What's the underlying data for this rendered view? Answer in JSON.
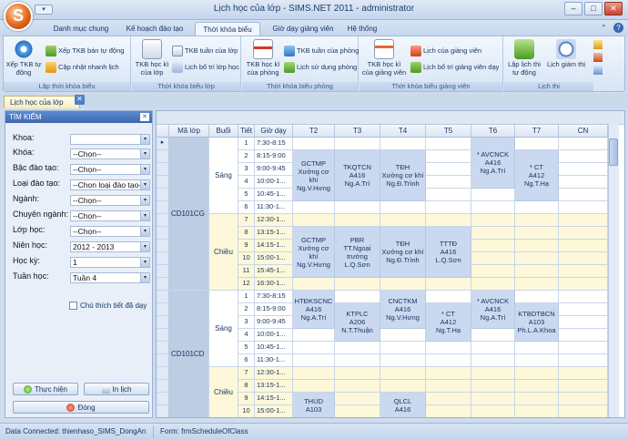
{
  "window": {
    "title": "Lịch học của lớp - SIMS.NET 2011 - administrator",
    "minimize": "–",
    "maximize": "□",
    "close": "✕"
  },
  "logo_letter": "S",
  "ribbon_tabs": [
    "Danh mục chung",
    "Kế hoạch đào tạo",
    "Thời khóa biểu",
    "Giờ dạy giảng viên",
    "Hệ thống"
  ],
  "ribbon_groups": {
    "g1": {
      "label": "Lập thời khóa biểu",
      "big": "Xếp TKB tự động",
      "s1": "Xếp TKB bán tự động",
      "s2": "Cập nhật nhanh lịch"
    },
    "g2": {
      "label": "Thời khóa biểu lớp",
      "big": "TKB học kì của lớp",
      "s1": "TKB tuần của lớp",
      "s2": "Lịch bố trí lớp học"
    },
    "g3": {
      "label": "Thời khóa biểu phòng",
      "big": "TKB học kì của phòng",
      "s1": "TKB tuần của phòng",
      "s2": "Lịch sử dụng phòng"
    },
    "g4": {
      "label": "Thời khóa biểu giảng viên",
      "big": "TKB học kì của giảng viên",
      "s1": "Lịch của giảng viên",
      "s2": "Lịch bố trí giảng viên dạy"
    },
    "g5": {
      "label": "Lịch thi",
      "b1": "Lập lịch thi tự động",
      "b2": "Lịch giám thị"
    }
  },
  "doc_tab": "Lịch học của lớp",
  "search_panel": {
    "title": "TÌM KIẾM",
    "fields": [
      {
        "label": "Khoa:",
        "value": ""
      },
      {
        "label": "Khóa:",
        "value": "--Chọn--"
      },
      {
        "label": "Bậc đào tạo:",
        "value": "--Chọn--"
      },
      {
        "label": "Loại đào tạo:",
        "value": "--Chọn loại đào tạo--"
      },
      {
        "label": "Ngành:",
        "value": "--Chọn--"
      },
      {
        "label": "Chuyên ngành:",
        "value": "--Chọn--"
      },
      {
        "label": "Lớp học:",
        "value": "--Chọn--"
      },
      {
        "label": "Niên học:",
        "value": "2012 - 2013"
      },
      {
        "label": "Học kỳ:",
        "value": "1"
      },
      {
        "label": "Tuần học:",
        "value": "Tuần 4"
      }
    ],
    "checkbox_label": "Chú thích tiết đã dạy",
    "execute": "Thực hiện",
    "print": "In lịch",
    "close": "Đóng"
  },
  "grid": {
    "columns": [
      "Mã lớp",
      "Buổi",
      "Tiết",
      "Giờ dạy",
      "T2",
      "T3",
      "T4",
      "T5",
      "T6",
      "T7",
      "CN"
    ],
    "row_marker": "▸",
    "classes": [
      {
        "code": "CD101CG",
        "sessions": [
          {
            "name": "Sáng",
            "periods": [
              {
                "n": "1",
                "time": "7:30-8:15"
              },
              {
                "n": "2",
                "time": "8:15-9:00"
              },
              {
                "n": "3",
                "time": "9:00-9:45"
              },
              {
                "n": "4",
                "time": "10:00-1..."
              },
              {
                "n": "5",
                "time": "10:45-1..."
              },
              {
                "n": "6",
                "time": "11:30-1..."
              }
            ]
          },
          {
            "name": "Chiều",
            "periods": [
              {
                "n": "7",
                "time": "12:30-1..."
              },
              {
                "n": "8",
                "time": "13:15-1..."
              },
              {
                "n": "9",
                "time": "14:15-1..."
              },
              {
                "n": "10",
                "time": "15:00-1..."
              },
              {
                "n": "11",
                "time": "15:45-1..."
              },
              {
                "n": "12",
                "time": "16:30-1..."
              }
            ]
          }
        ]
      },
      {
        "code": "CD101CD",
        "sessions": [
          {
            "name": "Sáng",
            "periods": [
              {
                "n": "1",
                "time": "7:30-8:15"
              },
              {
                "n": "2",
                "time": "8:15-9:00"
              },
              {
                "n": "3",
                "time": "9:00-9:45"
              },
              {
                "n": "4",
                "time": "10:00-1..."
              },
              {
                "n": "5",
                "time": "10:45-1..."
              },
              {
                "n": "6",
                "time": "11:30-1..."
              }
            ]
          },
          {
            "name": "Chiều",
            "periods": [
              {
                "n": "7",
                "time": "12:30-1..."
              },
              {
                "n": "8",
                "time": "13:15-1..."
              },
              {
                "n": "9",
                "time": "14:15-1..."
              },
              {
                "n": "10",
                "time": "15:00-1..."
              }
            ]
          }
        ]
      }
    ],
    "lessons": [
      {
        "id": "l1",
        "lines": [
          "GCTMP",
          "Xưởng cơ khí",
          "Ng.V.Hưng"
        ]
      },
      {
        "id": "l2",
        "lines": [
          "TKQTCN",
          "A416",
          "Ng.A.Trí"
        ]
      },
      {
        "id": "l3",
        "lines": [
          "TĐH",
          "Xưởng cơ khí",
          "Ng.Đ.Trình"
        ]
      },
      {
        "id": "l4",
        "lines": [
          "* AVCNCK",
          "A416",
          "Ng.A.Trí"
        ]
      },
      {
        "id": "l5",
        "lines": [
          "* CT",
          "A412",
          "Ng.T.Hạ"
        ]
      },
      {
        "id": "l6",
        "lines": [
          "GCTMP",
          "Xưởng cơ khí",
          "Ng.V.Hưng"
        ]
      },
      {
        "id": "l7",
        "lines": [
          "PBR",
          "TT.Ngoại",
          "trường",
          "L.Q.Sơn"
        ]
      },
      {
        "id": "l8",
        "lines": [
          "TĐH",
          "Xưởng cơ khí",
          "Ng.Đ.Trình"
        ]
      },
      {
        "id": "l9",
        "lines": [
          "TTTĐ",
          "A416",
          "L.Q.Sơn"
        ]
      },
      {
        "id": "l10",
        "lines": [
          "HTĐKSCNC",
          "A416",
          "Ng.A.Trí"
        ]
      },
      {
        "id": "l11",
        "lines": [
          "KTPLC",
          "A206",
          "N.T.Thuận"
        ]
      },
      {
        "id": "l12",
        "lines": [
          "CNCTKM",
          "A416",
          "Ng.V.Hưng"
        ]
      },
      {
        "id": "l13",
        "lines": [
          "* CT",
          "A412",
          "Ng.T.Hạ"
        ]
      },
      {
        "id": "l14",
        "lines": [
          "* AVCNCK",
          "A416",
          "Ng.A.Trí"
        ]
      },
      {
        "id": "l15",
        "lines": [
          "KTBDTBCN",
          "A103",
          "Ph.L.A.Khoa"
        ]
      },
      {
        "id": "l16",
        "lines": [
          "THUD",
          "A103"
        ]
      },
      {
        "id": "l17",
        "lines": [
          "QLCL",
          "A416"
        ]
      }
    ]
  },
  "status": {
    "connection": "Data Connected: thienhaso_SIMS_DongAn",
    "form": "Form: frmScheduleOfClass"
  },
  "colors": {
    "accent": "#3c67b0",
    "lesson_fill": "#cad9ef",
    "afternoon_fill": "#fcf8d9"
  }
}
